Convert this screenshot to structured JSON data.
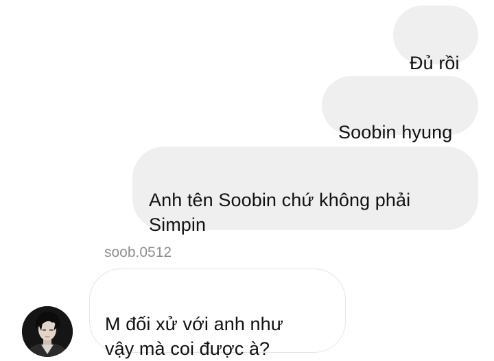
{
  "chat": {
    "messages": [
      {
        "direction": "sent",
        "text": "Đủ rồi"
      },
      {
        "direction": "sent",
        "text": "Soobin hyung"
      },
      {
        "direction": "sent",
        "text": "Anh tên Soobin chứ không phải\nSimpin"
      },
      {
        "direction": "received",
        "sender": "soob.0512",
        "text": "M đối xử với anh như\nvậy mà coi được à?"
      }
    ]
  },
  "colors": {
    "sent_bubble": "#efefef",
    "received_border": "#e4e4e4",
    "sender_name": "#8e8e8e",
    "text": "#111111"
  },
  "icons": {
    "avatar": "profile-photo"
  }
}
